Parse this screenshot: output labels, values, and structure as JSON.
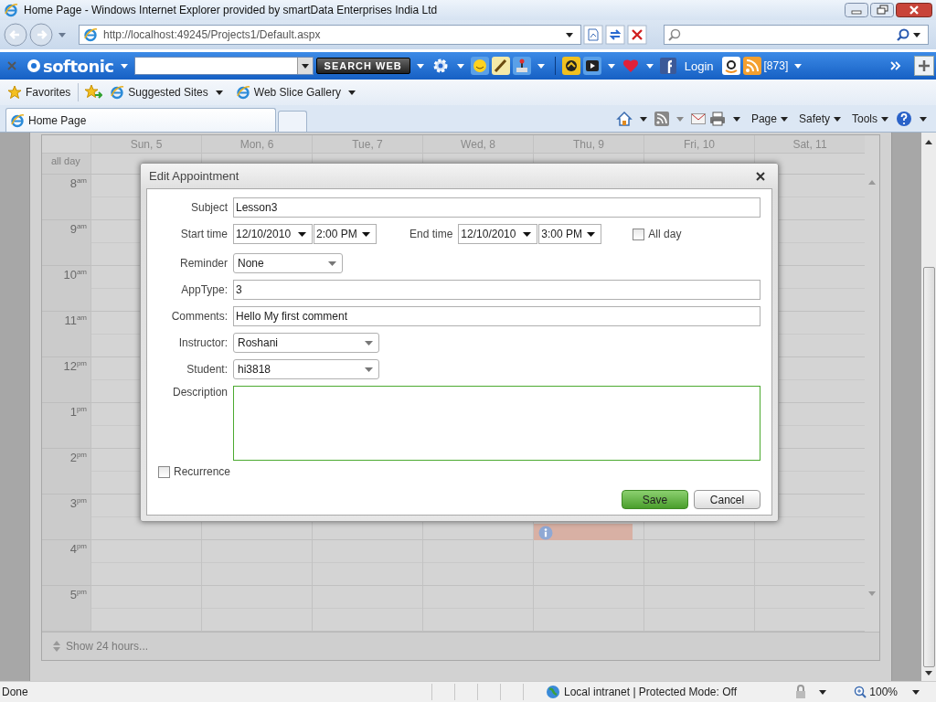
{
  "browser": {
    "title": "Home Page - Windows Internet Explorer provided by smartData Enterprises India Ltd",
    "address": "http://localhost:49245/Projects1/Default.aspx"
  },
  "toolbar": {
    "brand": "softonic",
    "search_button": "SEARCH WEB",
    "login": "Login",
    "count": "[873]"
  },
  "favorites_bar": {
    "favorites": "Favorites",
    "links": [
      "Suggested Sites",
      "Web Slice Gallery"
    ]
  },
  "tabs": [
    {
      "label": "Home Page",
      "selected": true
    }
  ],
  "command_bar": [
    "Page",
    "Safety",
    "Tools"
  ],
  "calendar": {
    "days": [
      "Sun, 5",
      "Mon, 6",
      "Tue, 7",
      "Wed, 8",
      "Thu, 9",
      "Fri, 10",
      "Sat, 11"
    ],
    "all_day": "all day",
    "hours": [
      {
        "hour": "8",
        "suffix": "am"
      },
      {
        "hour": "9",
        "suffix": "am"
      },
      {
        "hour": "10",
        "suffix": "am"
      },
      {
        "hour": "11",
        "suffix": "am"
      },
      {
        "hour": "12",
        "suffix": "pm"
      },
      {
        "hour": "1",
        "suffix": "pm"
      },
      {
        "hour": "2",
        "suffix": "pm"
      },
      {
        "hour": "3",
        "suffix": "pm"
      },
      {
        "hour": "4",
        "suffix": "pm"
      },
      {
        "hour": "5",
        "suffix": "pm"
      }
    ],
    "footer": "Show 24 hours..."
  },
  "dialog": {
    "title": "Edit Appointment",
    "subject": {
      "label": "Subject",
      "value": "Lesson3"
    },
    "start": {
      "label": "Start time",
      "date": "12/10/2010",
      "time": "2:00 PM"
    },
    "end": {
      "label": "End time",
      "date": "12/10/2010",
      "time": "3:00 PM"
    },
    "all_day": {
      "label": "All day",
      "checked": false
    },
    "reminder": {
      "label": "Reminder",
      "value": "None"
    },
    "app_type": {
      "label": "AppType:",
      "value": "3"
    },
    "comments": {
      "label": "Comments:",
      "value": "Hello My first comment"
    },
    "instructor": {
      "label": "Instructor:",
      "value": "Roshani"
    },
    "student": {
      "label": "Student:",
      "value": "hi3818"
    },
    "description": {
      "label": "Description",
      "focused": true
    },
    "recurrence": {
      "label": "Recurrence",
      "checked": false
    },
    "buttons": [
      {
        "label": "Save",
        "kind": "primary"
      },
      {
        "label": "Cancel",
        "kind": "secondary"
      }
    ]
  },
  "status_bar": {
    "status": "Done",
    "zone": "Local intranet | Protected Mode: Off",
    "zoom": "100%"
  }
}
